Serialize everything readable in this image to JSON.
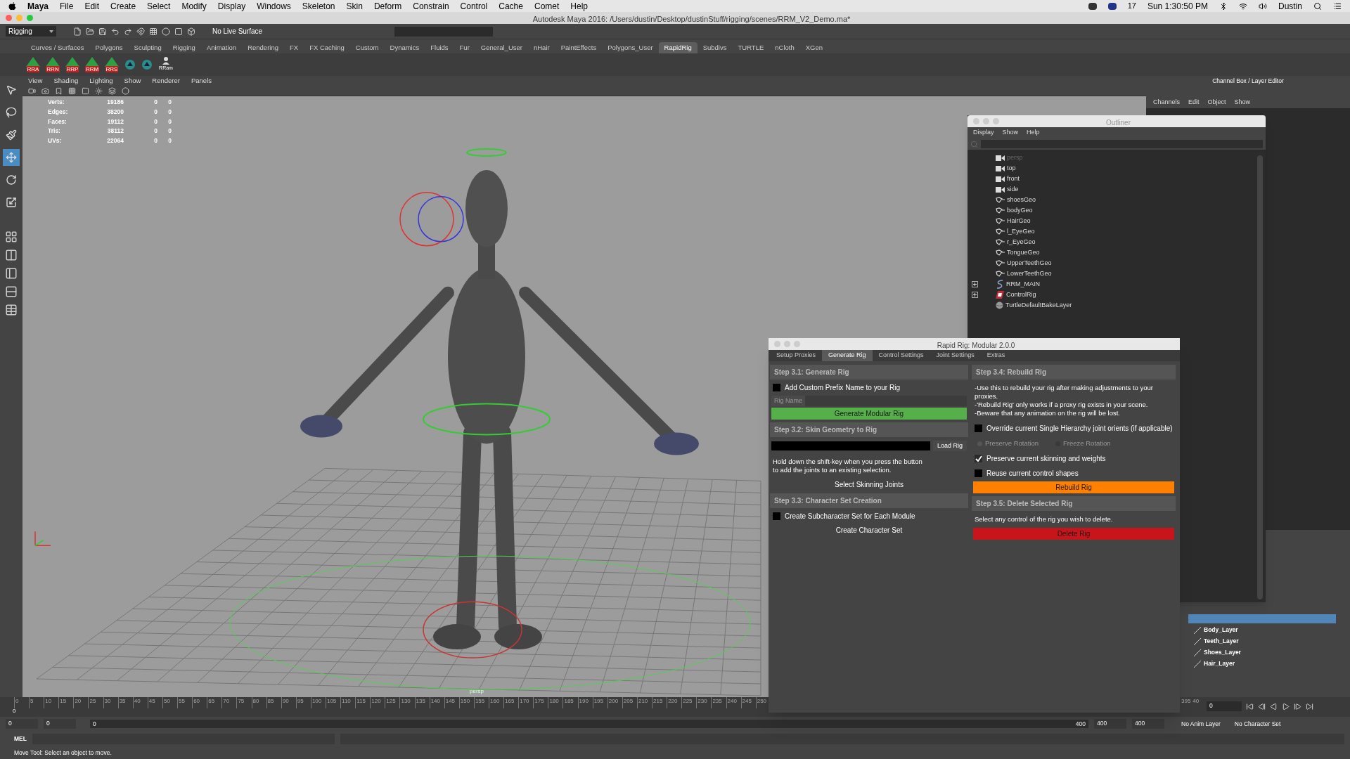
{
  "menubar": {
    "app": "Maya",
    "items": [
      "File",
      "Edit",
      "Create",
      "Select",
      "Modify",
      "Display",
      "Windows",
      "Skeleton",
      "Skin",
      "Deform",
      "Constrain",
      "Control",
      "Cache",
      "Comet",
      "Help"
    ],
    "badge": "17",
    "clock": "Sun 1:30:50 PM",
    "user": "Dustin"
  },
  "window": {
    "title": "Autodesk Maya 2016: /Users/dustin/Desktop/dustinStuff/rigging/scenes/RRM_V2_Demo.ma*"
  },
  "status_line": {
    "menu_set": "Rigging",
    "live_surface": "No Live Surface"
  },
  "shelf": {
    "tabs": [
      {
        "label": "Curves / Surfaces",
        "selected": false
      },
      {
        "label": "Polygons",
        "selected": false
      },
      {
        "label": "Sculpting",
        "selected": false
      },
      {
        "label": "Rigging",
        "selected": false
      },
      {
        "label": "Animation",
        "selected": false
      },
      {
        "label": "Rendering",
        "selected": false
      },
      {
        "label": "FX",
        "selected": false
      },
      {
        "label": "FX Caching",
        "selected": false
      },
      {
        "label": "Custom",
        "selected": false
      },
      {
        "label": "Dynamics",
        "selected": false
      },
      {
        "label": "Fluids",
        "selected": false
      },
      {
        "label": "Fur",
        "selected": false
      },
      {
        "label": "General_User",
        "selected": false
      },
      {
        "label": "nHair",
        "selected": false
      },
      {
        "label": "PaintEffects",
        "selected": false
      },
      {
        "label": "Polygons_User",
        "selected": false
      },
      {
        "label": "RapidRig",
        "selected": true
      },
      {
        "label": "Subdivs",
        "selected": false
      },
      {
        "label": "TURTLE",
        "selected": false
      },
      {
        "label": "nCloth",
        "selected": false
      },
      {
        "label": "XGen",
        "selected": false
      }
    ],
    "tools": [
      {
        "kind": "rig",
        "label": "RRA"
      },
      {
        "kind": "rig",
        "label": "RRN"
      },
      {
        "kind": "rig",
        "label": "RRP"
      },
      {
        "kind": "rig",
        "label": "RRM"
      },
      {
        "kind": "rig",
        "label": "RRS"
      },
      {
        "kind": "util"
      },
      {
        "kind": "util"
      },
      {
        "kind": "person",
        "label": "RRam"
      }
    ]
  },
  "toolbox": [
    {
      "selected": false
    },
    {
      "selected": false
    },
    {
      "selected": false
    },
    {
      "selected": true
    },
    {
      "selected": false
    },
    {
      "selected": false
    }
  ],
  "viewport": {
    "menu": [
      "View",
      "Shading",
      "Lighting",
      "Show",
      "Renderer",
      "Panels"
    ],
    "stats": [
      [
        "Verts:",
        "19186",
        "0",
        "0"
      ],
      [
        "Edges:",
        "38200",
        "0",
        "0"
      ],
      [
        "Faces:",
        "19112",
        "0",
        "0"
      ],
      [
        "Tris:",
        "38112",
        "0",
        "0"
      ],
      [
        "UVs:",
        "22064",
        "0",
        "0"
      ]
    ],
    "camera": "persp"
  },
  "channel_box": {
    "title": "Channel Box / Layer Editor",
    "menu": [
      "Channels",
      "Edit",
      "Object",
      "Show"
    ],
    "layers": [
      {
        "selected": true
      },
      {
        "name": "Body_Layer",
        "selected": false
      },
      {
        "name": "Teeth_Layer",
        "selected": false
      },
      {
        "name": "Shoes_Layer",
        "selected": false
      },
      {
        "name": "Hair_Layer",
        "selected": false
      }
    ]
  },
  "outliner": {
    "title": "Outliner",
    "menu": [
      "Display",
      "Show",
      "Help"
    ],
    "items": [
      {
        "kind": "camera",
        "label": "persp",
        "dimmed": true
      },
      {
        "kind": "camera",
        "label": "top",
        "dimmed": false
      },
      {
        "kind": "camera",
        "label": "front",
        "dimmed": false
      },
      {
        "kind": "camera",
        "label": "side",
        "dimmed": false
      },
      {
        "kind": "mesh",
        "label": "shoesGeo",
        "dimmed": false
      },
      {
        "kind": "mesh",
        "label": "bodyGeo",
        "dimmed": false
      },
      {
        "kind": "mesh",
        "label": "HairGeo",
        "dimmed": false
      },
      {
        "kind": "mesh",
        "label": "l_EyeGeo",
        "dimmed": false
      },
      {
        "kind": "mesh",
        "label": "r_EyeGeo",
        "dimmed": false
      },
      {
        "kind": "mesh",
        "label": "TongueGeo",
        "dimmed": false
      },
      {
        "kind": "mesh",
        "label": "UpperTeethGeo",
        "dimmed": false
      },
      {
        "kind": "mesh",
        "label": "LowerTeethGeo",
        "dimmed": false
      },
      {
        "kind": "group",
        "label": "RRM_MAIN",
        "dimmed": false,
        "expanded": false
      },
      {
        "kind": "set",
        "label": "ControlRig",
        "dimmed": false,
        "expanded": false
      },
      {
        "kind": "layer",
        "label": "TurtleDefaultBakeLayer",
        "dimmed": false
      }
    ]
  },
  "rapid_rig": {
    "title": "Rapid Rig: Modular 2.0.0",
    "tabs": [
      {
        "label": "Setup Proxies",
        "selected": false
      },
      {
        "label": "Generate Rig",
        "selected": true
      },
      {
        "label": "Control Settings",
        "selected": false
      },
      {
        "label": "Joint Settings",
        "selected": false
      },
      {
        "label": "Extras",
        "selected": false
      }
    ],
    "left": [
      {
        "kind": "header",
        "text": "Step 3.1: Generate Rig"
      },
      {
        "kind": "checkbox",
        "label": "Add Custom Prefix Name to your Rig",
        "checked": false
      },
      {
        "kind": "field",
        "placeholder": "Rig Name"
      },
      {
        "kind": "button",
        "label": "Generate Modular Rig",
        "color": "#55b04a"
      },
      {
        "kind": "header",
        "text": "Step 3.2: Skin Geometry to Rig"
      },
      {
        "kind": "load",
        "label": "Load Rig"
      },
      {
        "kind": "text",
        "text": "Hold down the shift-key when you press the button\nto add the joints to an existing selection."
      },
      {
        "kind": "button",
        "label": "Select Skinning Joints"
      },
      {
        "kind": "header",
        "text": "Step 3.3: Character Set Creation"
      },
      {
        "kind": "checkbox",
        "label": "Create Subcharacter Set for Each Module",
        "checked": false
      },
      {
        "kind": "button",
        "label": "Create Character Set"
      }
    ],
    "right": [
      {
        "kind": "header",
        "text": "Step 3.4: Rebuild Rig"
      },
      {
        "kind": "text",
        "text": "-Use this to rebuild your rig after making adjustments to your\nproxies.\n-'Rebuild Rig' only works if a proxy rig exists in your scene.\n-Beware that any animation on the rig will be lost."
      },
      {
        "kind": "checkbox",
        "label": "Override current Single Hierarchy joint orients (if applicable)",
        "checked": false
      },
      {
        "kind": "radios",
        "disabled": true,
        "options": [
          {
            "label": "Preserve Rotation",
            "selected": true
          },
          {
            "label": "Freeze Rotation",
            "selected": false
          }
        ]
      },
      {
        "kind": "checkbox",
        "label": "Preserve current skinning and weights",
        "checked": true
      },
      {
        "kind": "checkbox",
        "label": "Reuse current control shapes",
        "checked": false
      },
      {
        "kind": "button",
        "label": "Rebuild Rig",
        "color": "#ff8000"
      },
      {
        "kind": "header",
        "text": "Step 3.5: Delete Selected Rig"
      },
      {
        "kind": "text",
        "text": "Select any control of the rig you wish to delete."
      },
      {
        "kind": "button",
        "label": "Delete Rig",
        "color": "#c8151b"
      }
    ]
  },
  "timeline": {
    "ticks": [
      "0",
      "5",
      "10",
      "15",
      "20",
      "25",
      "30",
      "35",
      "40",
      "45",
      "50",
      "55",
      "60",
      "65",
      "70",
      "75",
      "80",
      "85",
      "90",
      "95",
      "100",
      "105",
      "110",
      "115",
      "120",
      "125",
      "130",
      "135",
      "140",
      "145",
      "150",
      "155",
      "160",
      "165",
      "170",
      "175",
      "180",
      "185",
      "190",
      "195",
      "200",
      "205",
      "210",
      "215",
      "220",
      "225",
      "230",
      "235",
      "240",
      "245",
      "250"
    ],
    "tail": [
      "395",
      "40"
    ],
    "marker": "0",
    "current_frame": "0"
  },
  "range": {
    "start": "0",
    "playback_start": "0",
    "slider_start": "0",
    "slider_end": "400",
    "playback_end": "400",
    "end": "400",
    "anim_layer": "No Anim Layer",
    "character_set": "No Character Set"
  },
  "command_line": {
    "label": "MEL"
  },
  "help_line": "Move Tool: Select an object to move."
}
